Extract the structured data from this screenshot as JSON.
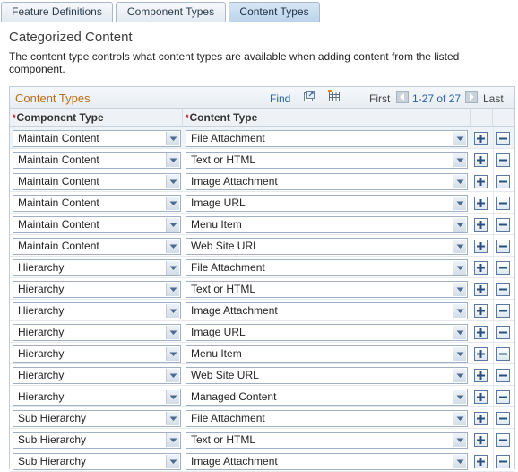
{
  "tabs": [
    {
      "label": "Feature Definitions",
      "active": false
    },
    {
      "label": "Component Types",
      "active": false
    },
    {
      "label": "Content Types",
      "active": true
    }
  ],
  "page_title": "Categorized Content",
  "description": "The content type controls what content types are available when adding content from the listed component.",
  "grid": {
    "title": "Content Types",
    "find_label": "Find",
    "first_label": "First",
    "range_label": "1-27 of 27",
    "last_label": "Last",
    "columns": [
      {
        "required_marker": "*",
        "label": "Component Type"
      },
      {
        "required_marker": "*",
        "label": "Content Type"
      }
    ],
    "rows": [
      {
        "component_type": "Maintain Content",
        "content_type": "File Attachment"
      },
      {
        "component_type": "Maintain Content",
        "content_type": "Text or HTML"
      },
      {
        "component_type": "Maintain Content",
        "content_type": "Image Attachment"
      },
      {
        "component_type": "Maintain Content",
        "content_type": "Image URL"
      },
      {
        "component_type": "Maintain Content",
        "content_type": "Menu Item"
      },
      {
        "component_type": "Maintain Content",
        "content_type": "Web Site URL"
      },
      {
        "component_type": "Hierarchy",
        "content_type": "File Attachment"
      },
      {
        "component_type": "Hierarchy",
        "content_type": "Text or HTML"
      },
      {
        "component_type": "Hierarchy",
        "content_type": "Image Attachment"
      },
      {
        "component_type": "Hierarchy",
        "content_type": "Image URL"
      },
      {
        "component_type": "Hierarchy",
        "content_type": "Menu Item"
      },
      {
        "component_type": "Hierarchy",
        "content_type": "Web Site URL"
      },
      {
        "component_type": "Hierarchy",
        "content_type": "Managed Content"
      },
      {
        "component_type": "Sub Hierarchy",
        "content_type": "File Attachment"
      },
      {
        "component_type": "Sub Hierarchy",
        "content_type": "Text or HTML"
      },
      {
        "component_type": "Sub Hierarchy",
        "content_type": "Image Attachment"
      }
    ]
  },
  "icons": {
    "view_all": "view-all-icon",
    "download": "grid-download-icon",
    "prev": "prev-arrow-icon",
    "next": "next-arrow-icon",
    "dropdown": "chevron-down-icon",
    "add": "plus-icon",
    "delete": "minus-icon"
  },
  "colors": {
    "grid_title": "#b8701e",
    "link": "#2a5fa3",
    "required": "#b11111",
    "active_tab": "#bcd3ea"
  }
}
